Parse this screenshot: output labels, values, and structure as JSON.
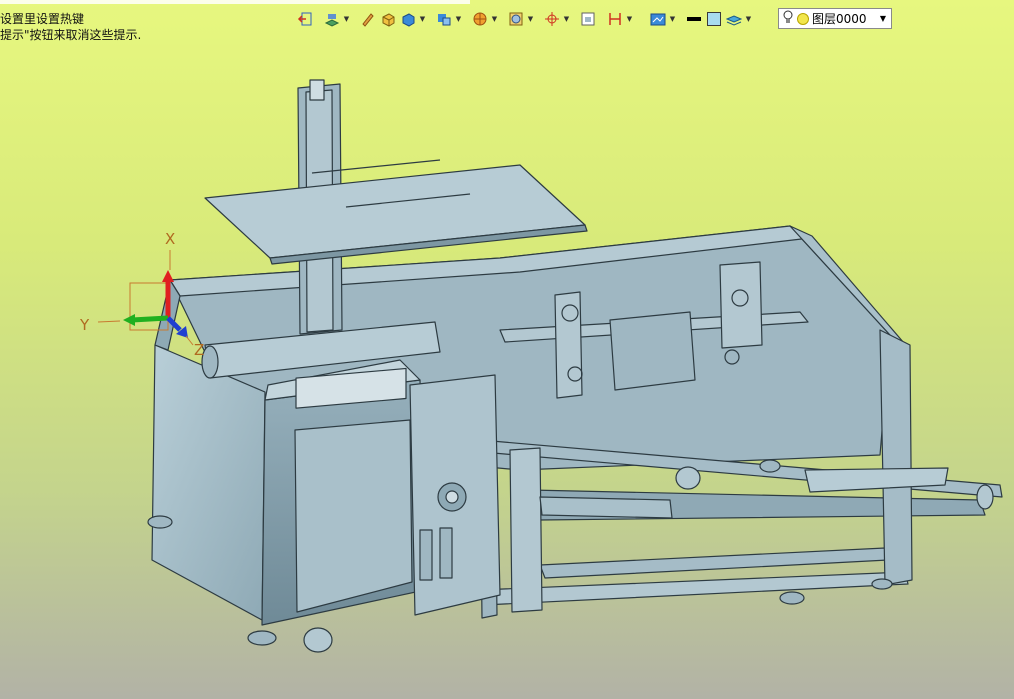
{
  "hints": {
    "line1": "设置里设置热键",
    "line2": "提示\"按钮来取消这些提示."
  },
  "toolbar": {
    "icons": [
      "exit-sketch-icon",
      "sketch-plane-icon",
      "pencil-icon",
      "solid-box-icon",
      "shaded-cube-icon",
      "view-orientation-icon",
      "render-style-icon",
      "section-view-icon",
      "coordinate-axis-icon",
      "fit-view-icon",
      "dimension-icon",
      "display-mode-icon",
      "line-color-icon",
      "fill-color-icon",
      "layer-stack-icon"
    ]
  },
  "layer": {
    "value": "图层0000"
  },
  "triad": {
    "x_label": "X",
    "y_label": "Y",
    "z_label": "Z"
  },
  "colors": {
    "model": "#a7bfca",
    "model_dark": "#6f8a97",
    "edge": "#2d3b42",
    "axis_x": "#e02020",
    "axis_y": "#20b020",
    "axis_z": "#2040d0",
    "axis_label": "#b06a20"
  }
}
